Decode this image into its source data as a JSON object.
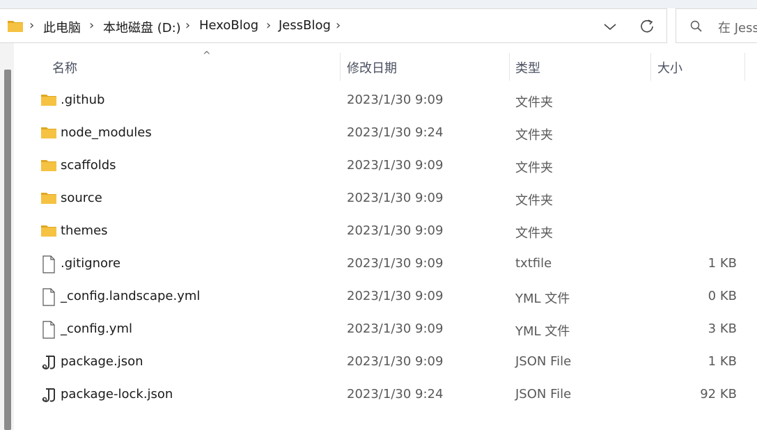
{
  "breadcrumb": {
    "items": [
      "此电脑",
      "本地磁盘 (D:)",
      "HexoBlog",
      "JessBlog"
    ]
  },
  "search": {
    "text": "在 Jess"
  },
  "columns": {
    "name": "名称",
    "date": "修改日期",
    "type": "类型",
    "size": "大小"
  },
  "files": [
    {
      "name": ".github",
      "date": "2023/1/30 9:09",
      "type": "文件夹",
      "size": "",
      "icon": "folder-icon"
    },
    {
      "name": "node_modules",
      "date": "2023/1/30 9:24",
      "type": "文件夹",
      "size": "",
      "icon": "folder-icon"
    },
    {
      "name": "scaffolds",
      "date": "2023/1/30 9:09",
      "type": "文件夹",
      "size": "",
      "icon": "folder-icon"
    },
    {
      "name": "source",
      "date": "2023/1/30 9:09",
      "type": "文件夹",
      "size": "",
      "icon": "folder-icon"
    },
    {
      "name": "themes",
      "date": "2023/1/30 9:09",
      "type": "文件夹",
      "size": "",
      "icon": "folder-icon"
    },
    {
      "name": ".gitignore",
      "date": "2023/1/30 9:09",
      "type": "txtfile",
      "size": "1 KB",
      "icon": "file-icon"
    },
    {
      "name": "_config.landscape.yml",
      "date": "2023/1/30 9:09",
      "type": "YML 文件",
      "size": "0 KB",
      "icon": "file-icon"
    },
    {
      "name": "_config.yml",
      "date": "2023/1/30 9:09",
      "type": "YML 文件",
      "size": "3 KB",
      "icon": "file-icon"
    },
    {
      "name": "package.json",
      "date": "2023/1/30 9:09",
      "type": "JSON File",
      "size": "1 KB",
      "icon": "json-file-icon"
    },
    {
      "name": "package-lock.json",
      "date": "2023/1/30 9:24",
      "type": "JSON File",
      "size": "92 KB",
      "icon": "json-file-icon"
    }
  ],
  "colors": {
    "folder": "#f5c242",
    "folder_dark": "#e0a820",
    "text_secondary": "#595959"
  }
}
